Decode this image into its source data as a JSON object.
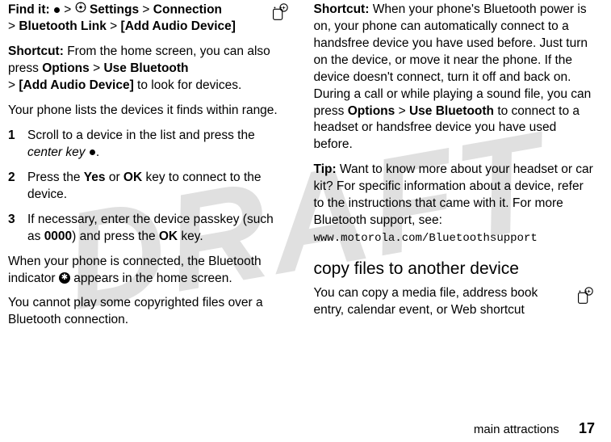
{
  "watermark": "DRAFT",
  "left": {
    "findit_label": "Find it:",
    "findit_path1": "Settings",
    "findit_path2": "Connection",
    "findit_path3": "Bluetooth Link",
    "findit_path4": "[Add Audio Device]",
    "shortcut_label": "Shortcut:",
    "shortcut_text1": " From the home screen, you can also press ",
    "shortcut_opt": "Options",
    "shortcut_use": "Use Bluetooth",
    "shortcut_add": "[Add Audio Device]",
    "shortcut_text2": " to look for devices.",
    "list_intro": "Your phone lists the devices it finds within range.",
    "step1_num": "1",
    "step1_text_a": "Scroll to a device in the list and press the ",
    "step1_text_b": "center key",
    "step1_text_c": ".",
    "step2_num": "2",
    "step2_text_a": "Press the ",
    "step2_yes": "Yes",
    "step2_or": " or ",
    "step2_ok": "OK",
    "step2_text_b": " key to connect to the device.",
    "step3_num": "3",
    "step3_text_a": "If necessary, enter the device passkey (such as ",
    "step3_code": "0000",
    "step3_text_b": ") and press the ",
    "step3_ok": "OK",
    "step3_text_c": " key.",
    "connected_a": "When your phone is connected, the Bluetooth indicator ",
    "connected_b": " appears in the home screen.",
    "copyright_note": "You cannot play some copyrighted files over a Bluetooth connection."
  },
  "right": {
    "shortcut_label": "Shortcut:",
    "shortcut_text": " When your phone's Bluetooth power is on, your phone can automatically connect to a handsfree device you have used before. Just turn on the device, or move it near the phone. If the device doesn't connect, turn it off and back on. During a call or while playing a sound file, you can press ",
    "shortcut_opt": "Options",
    "shortcut_use": "Use Bluetooth",
    "shortcut_text2": " to connect to a headset or handsfree device you have used before.",
    "tip_label": "Tip:",
    "tip_text": " Want to know more about your headset or car kit? For specific information about a device, refer to the instructions that came with it. For more Bluetooth support, see: ",
    "tip_url": "www.motorola.com/Bluetoothsupport",
    "heading": "copy files to another device",
    "copy_text": "You can copy a media file, address book entry, calendar event, or Web shortcut"
  },
  "footer": {
    "section": "main attractions",
    "page": "17"
  }
}
